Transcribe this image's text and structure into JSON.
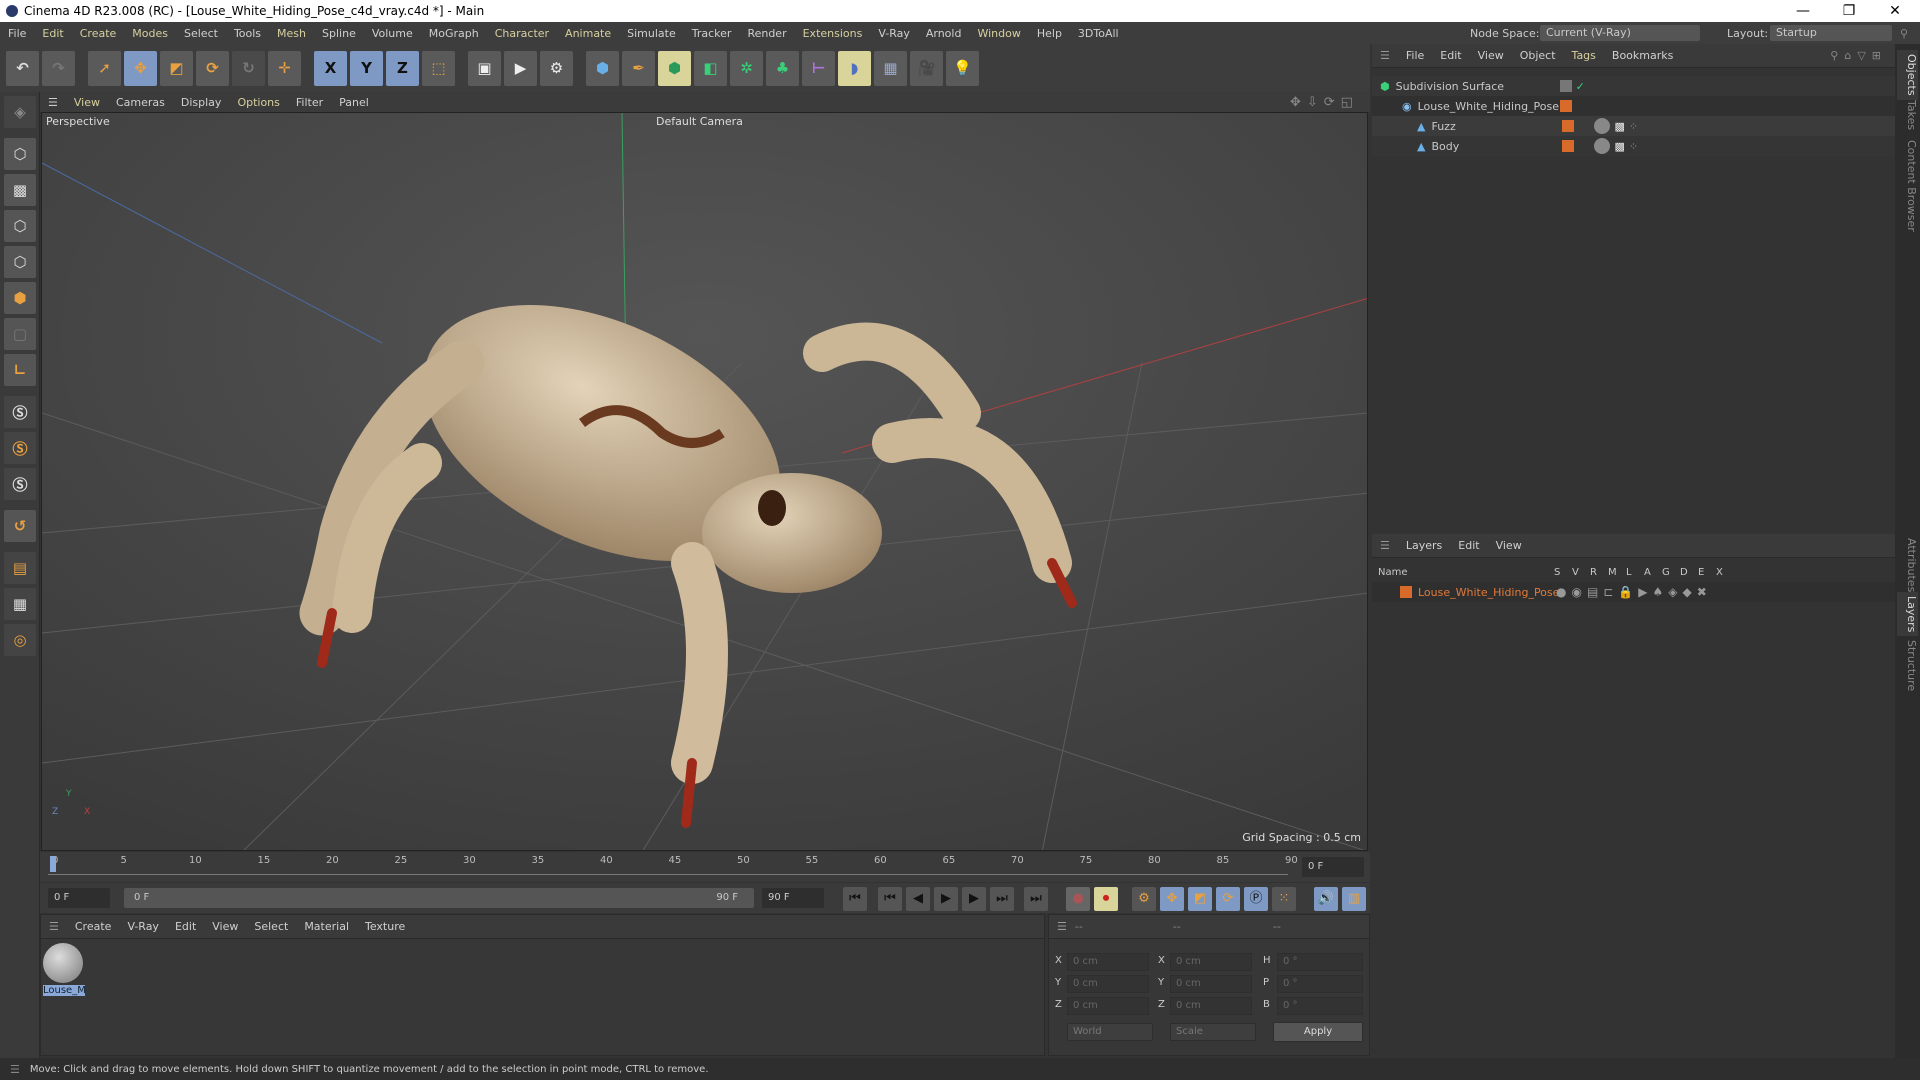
{
  "window": {
    "title": "Cinema 4D R23.008 (RC) - [Louse_White_Hiding_Pose_c4d_vray.c4d *] - Main",
    "minimize": "—",
    "restore": "❐",
    "close": "✕"
  },
  "menu": [
    "File",
    "Edit",
    "Create",
    "Modes",
    "Select",
    "Tools",
    "Mesh",
    "Spline",
    "Volume",
    "MoGraph",
    "Character",
    "Animate",
    "Simulate",
    "Tracker",
    "Render",
    "Extensions",
    "V-Ray",
    "Arnold",
    "Window",
    "Help",
    "3DToAll"
  ],
  "nodespace": {
    "label": "Node Space:",
    "value": "Current (V-Ray)"
  },
  "layout": {
    "label": "Layout:",
    "value": "Startup"
  },
  "toolbar": {
    "x": "X",
    "y": "Y",
    "z": "Z"
  },
  "viewport": {
    "menu": [
      "View",
      "Cameras",
      "Display",
      "Options",
      "Filter",
      "Panel"
    ],
    "name": "Perspective",
    "camera": "Default Camera",
    "grid_spacing": "Grid Spacing : 0.5 cm",
    "axis": {
      "y": "Y",
      "z": "Z",
      "x": "X"
    }
  },
  "timeline": {
    "ticks": [
      "0",
      "5",
      "10",
      "15",
      "20",
      "25",
      "30",
      "35",
      "40",
      "45",
      "50",
      "55",
      "60",
      "65",
      "70",
      "75",
      "80",
      "85",
      "90"
    ],
    "current": "0 F",
    "start": "0 F",
    "range_start": "0 F",
    "range_end": "90 F",
    "end": "90 F"
  },
  "materials": {
    "menu": [
      "Create",
      "V-Ray",
      "Edit",
      "View",
      "Select",
      "Material",
      "Texture"
    ],
    "items": [
      {
        "name": "Louse_M"
      }
    ]
  },
  "coords": {
    "headers": [
      "--",
      "--",
      "--"
    ],
    "pos": [
      {
        "l": "X",
        "v": "0 cm"
      },
      {
        "l": "Y",
        "v": "0 cm"
      },
      {
        "l": "Z",
        "v": "0 cm"
      }
    ],
    "size": [
      {
        "l": "X",
        "v": "0 cm"
      },
      {
        "l": "Y",
        "v": "0 cm"
      },
      {
        "l": "Z",
        "v": "0 cm"
      }
    ],
    "rot": [
      {
        "l": "H",
        "v": "0 °"
      },
      {
        "l": "P",
        "v": "0 °"
      },
      {
        "l": "B",
        "v": "0 °"
      }
    ],
    "mode": "World",
    "type": "Scale",
    "apply": "Apply"
  },
  "objects": {
    "menu": [
      "File",
      "Edit",
      "View",
      "Object",
      "Tags",
      "Bookmarks"
    ],
    "tree": [
      {
        "name": "Subdivision Surface"
      },
      {
        "name": "Louse_White_Hiding_Pose"
      },
      {
        "name": "Fuzz"
      },
      {
        "name": "Body"
      }
    ]
  },
  "layers": {
    "menu": [
      "Layers",
      "Edit",
      "View"
    ],
    "col_name": "Name",
    "cols": [
      "S",
      "V",
      "R",
      "M",
      "L",
      "A",
      "G",
      "D",
      "E",
      "X"
    ],
    "rows": [
      {
        "name": "Louse_White_Hiding_Pose",
        "color": "#d86a2a"
      }
    ]
  },
  "righttabs": [
    "Objects",
    "Takes",
    "Content Browser",
    "Attributes",
    "Layers",
    "Structure"
  ],
  "status": "Move: Click and drag to move elements. Hold down SHIFT to quantize movement / add to the selection in point mode, CTRL to remove."
}
